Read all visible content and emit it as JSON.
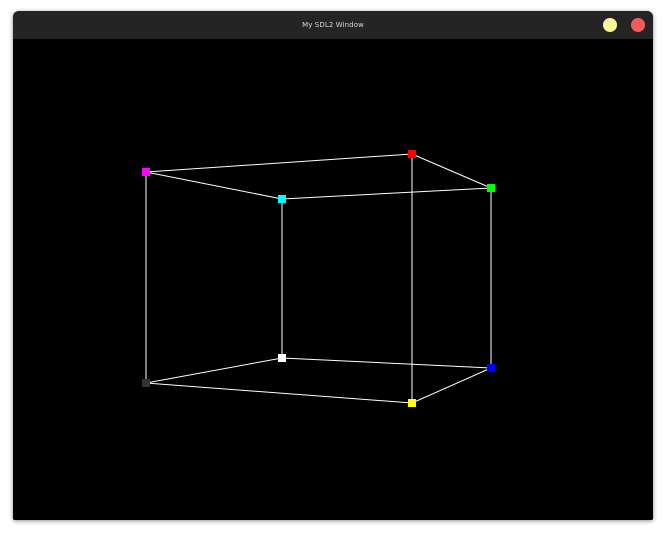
{
  "window": {
    "title": "My SDL2 Window",
    "minimize_color": "#f8f79a",
    "close_color": "#f45b59",
    "minimize_icon": "minimize-dot-icon",
    "close_icon": "close-dot-icon"
  },
  "cube": {
    "edge_color": "#ffffff",
    "background_color": "#000000",
    "vertices": [
      {
        "name": "magenta",
        "color": "#ff00ff"
      },
      {
        "name": "red",
        "color": "#ff0000"
      },
      {
        "name": "green",
        "color": "#00ff00"
      },
      {
        "name": "cyan",
        "color": "#00ffff"
      },
      {
        "name": "gray",
        "color": "#333333"
      },
      {
        "name": "white",
        "color": "#ffffff"
      },
      {
        "name": "blue",
        "color": "#0000ff"
      },
      {
        "name": "yellow",
        "color": "#ffff00"
      }
    ]
  }
}
